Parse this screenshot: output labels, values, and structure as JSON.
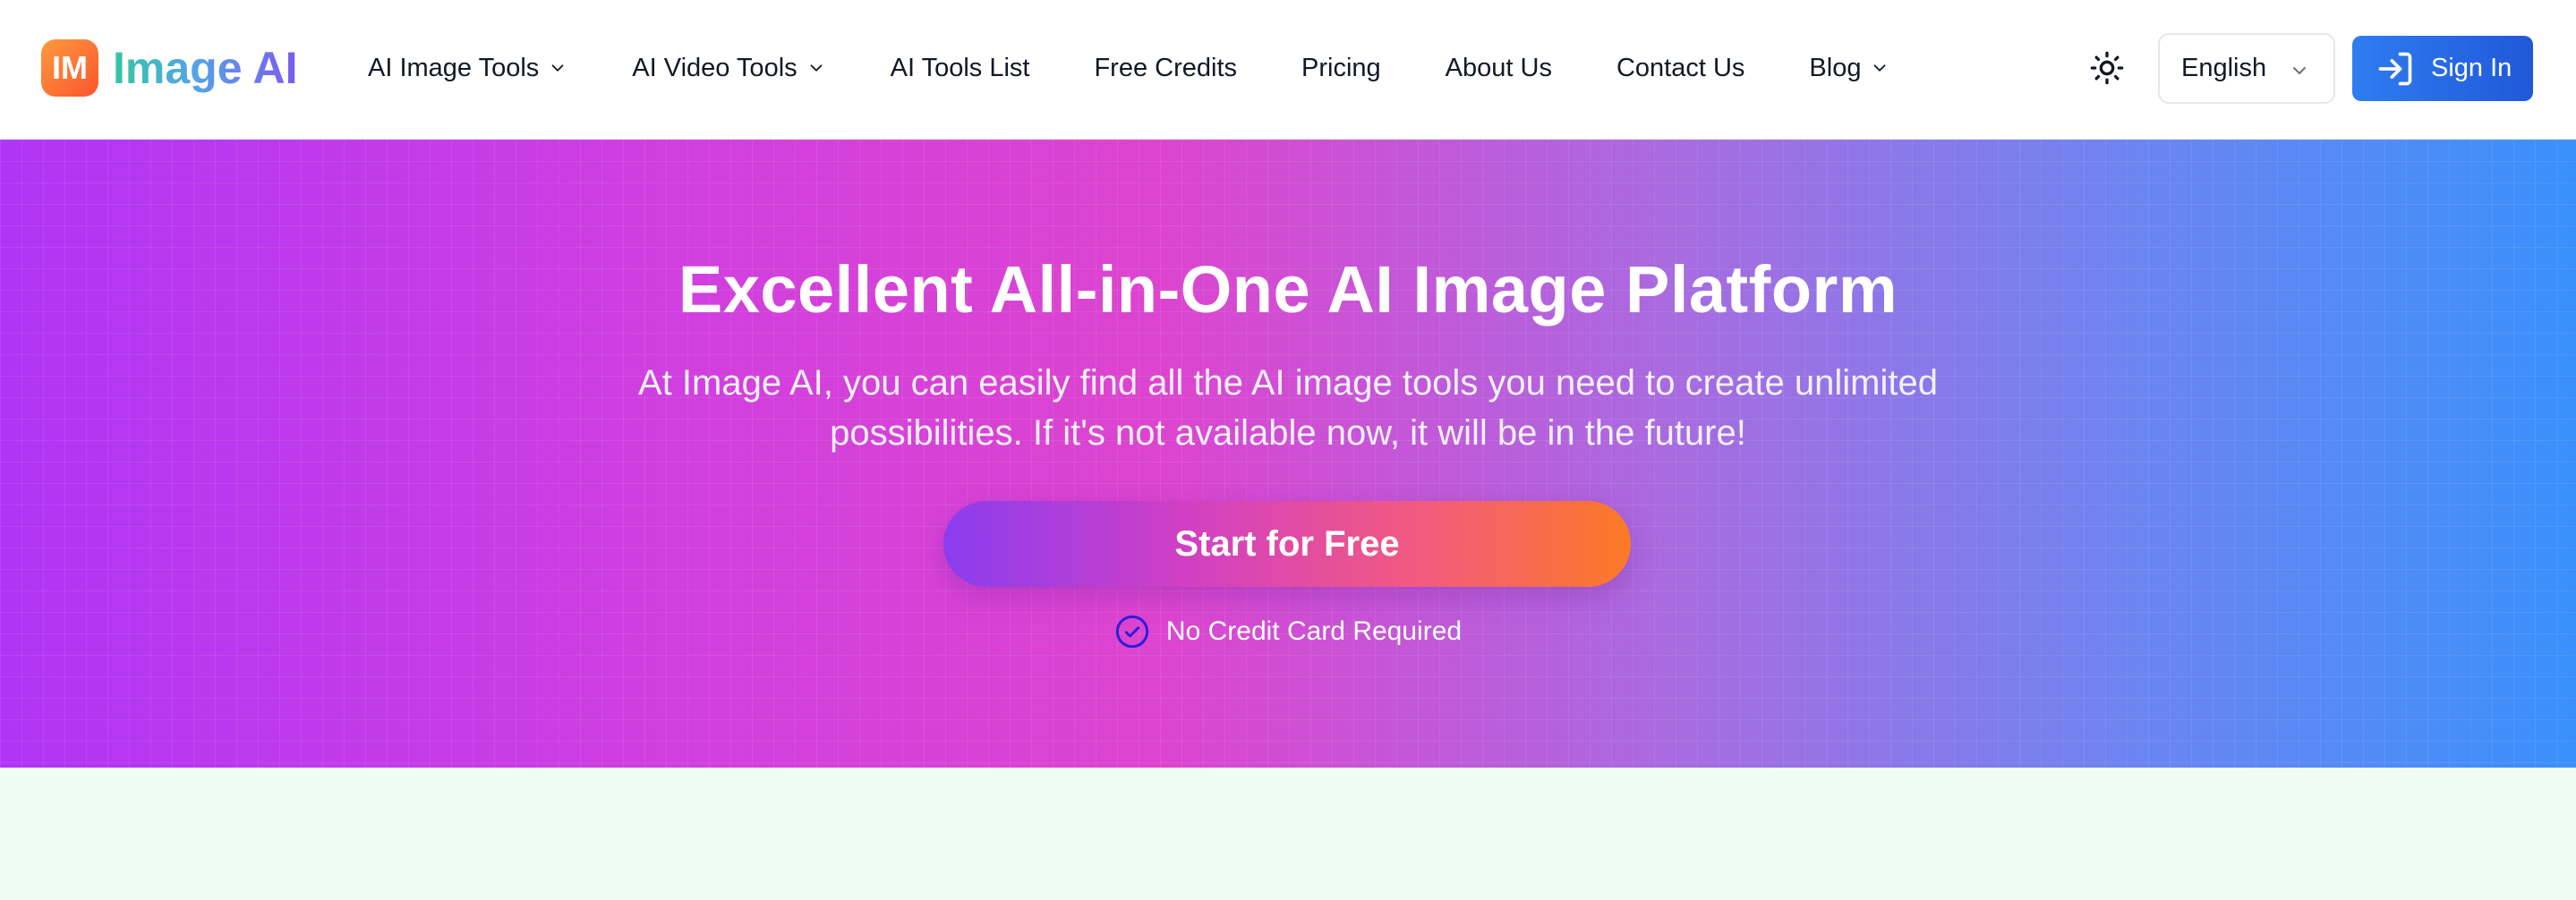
{
  "brand": {
    "badge": "IM",
    "name": "Image AI"
  },
  "nav": {
    "items": [
      {
        "label": "AI Image Tools",
        "has_dropdown": true
      },
      {
        "label": "AI Video Tools",
        "has_dropdown": true
      },
      {
        "label": "AI Tools List",
        "has_dropdown": false
      },
      {
        "label": "Free Credits",
        "has_dropdown": false
      },
      {
        "label": "Pricing",
        "has_dropdown": false
      },
      {
        "label": "About Us",
        "has_dropdown": false
      },
      {
        "label": "Contact Us",
        "has_dropdown": false
      },
      {
        "label": "Blog",
        "has_dropdown": true
      }
    ]
  },
  "header": {
    "theme_icon": "sun-icon",
    "language": "English",
    "signin_label": "Sign In",
    "signin_icon": "sign-in-icon"
  },
  "hero": {
    "title": "Excellent All-in-One AI Image Platform",
    "subtitle": "At Image AI, you can easily find all the AI image tools you need to create unlimited possibilities. If it's not available now, it will be in the future!",
    "cta_label": "Start for Free",
    "note": "No Credit Card Required",
    "note_icon": "check-circle-icon"
  },
  "colors": {
    "accent_blue": "#2f7df1",
    "hero_start": "#b035f5",
    "hero_mid": "#dd44cf",
    "hero_end": "#3a90fb",
    "cta_start": "#8a3df0",
    "cta_end": "#fb7a25",
    "below_bg": "#effcf2"
  }
}
